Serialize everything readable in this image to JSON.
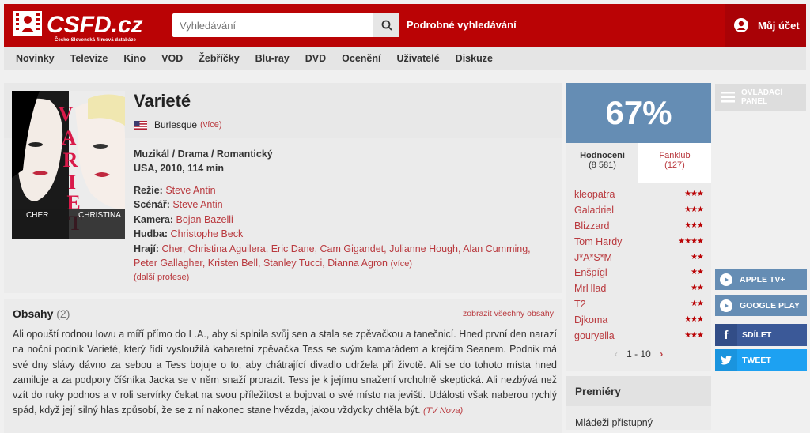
{
  "header": {
    "logo_text": "CSFD.cz",
    "logo_subtitle": "Česko-Slovenská filmová databáze",
    "search_placeholder": "Vyhledávání",
    "advanced_search": "Podrobné vyhledávání",
    "account": "Můj účet"
  },
  "nav": [
    "Novinky",
    "Televize",
    "Kino",
    "VOD",
    "Žebříčky",
    "Blu-ray",
    "DVD",
    "Ocenění",
    "Uživatelé",
    "Diskuze"
  ],
  "film": {
    "title": "Varieté",
    "original_title": "Burlesque",
    "more": "(více)",
    "genre": "Muzikál / Drama / Romantický",
    "origin": "USA, 2010, 114 min",
    "director_label": "Režie:",
    "director": "Steve Antin",
    "writer_label": "Scénář:",
    "writer": "Steve Antin",
    "camera_label": "Kamera:",
    "camera": "Bojan Bazelli",
    "music_label": "Hudba:",
    "music": "Christophe Beck",
    "cast_label": "Hrají:",
    "cast": "Cher, Christina Aguilera, Eric Dane, Cam Gigandet, Julianne Hough, Alan Cumming, Peter Gallagher, Kristen Bell, Stanley Tucci, Dianna Agron",
    "cast_more": "(více)",
    "other_professions": "(další profese)",
    "poster": {
      "title_letters": "VARIETÉ",
      "left_name": "CHER",
      "right_name": "CHRISTINA"
    }
  },
  "plots": {
    "title": "Obsahy",
    "count": "(2)",
    "show_all": "zobrazit všechny obsahy",
    "text": "Ali opouští rodnou Iowu a míří přímo do L.A., aby si splnila svůj sen a stala se zpěvačkou a tanečnicí. Hned první den narazí na noční podnik Varieté, který řídí vysloužilá kabaretní zpěvačka Tess se svým kamarádem a krejčím Seanem. Podnik má své dny slávy dávno za sebou a Tess bojuje o to, aby chátrající divadlo udržela při životě. Ali se do tohoto místa hned zamiluje a za podpory číšníka Jacka se v něm snaží prorazit. Tess je k jejímu snažení vrcholně skeptická. Ali nezbývá než vzít do ruky podnos a v roli servírky čekat na svou příležitost a bojovat o své místo na jevišti. Události však naberou rychlý spád, když její silný hlas způsobí, že se z ní nakonec stane hvězda, jakou vždycky chtěla být.",
    "source": "(TV Nova)"
  },
  "rating": {
    "percent": "67%",
    "tab_ratings": "Hodnocení",
    "tab_ratings_count": "(8 581)",
    "tab_fanclub": "Fanklub",
    "tab_fanclub_count": "(127)",
    "users": [
      {
        "name": "kleopatra",
        "stars": "★★★"
      },
      {
        "name": "Galadriel",
        "stars": "★★★"
      },
      {
        "name": "Blizzard",
        "stars": "★★★"
      },
      {
        "name": "Tom Hardy",
        "stars": "★★★★"
      },
      {
        "name": "J*A*S*M",
        "stars": "★★"
      },
      {
        "name": "Enšpígl",
        "stars": "★★"
      },
      {
        "name": "MrHlad",
        "stars": "★★"
      },
      {
        "name": "T2",
        "stars": "★★"
      },
      {
        "name": "Djkoma",
        "stars": "★★★"
      },
      {
        "name": "gouryella",
        "stars": "★★★"
      }
    ],
    "pager": "1 - 10",
    "pager_prev": "‹",
    "pager_next": "›"
  },
  "premieres": {
    "title": "Premiéry",
    "item": "Mládeži přístupný"
  },
  "sidebar": {
    "control_panel_line1": "OVLÁDACÍ",
    "control_panel_line2": "PANEL",
    "apple_tv": "APPLE TV+",
    "google_play": "GOOGLE PLAY",
    "share": "SDÍLET",
    "tweet": "TWEET"
  },
  "colors": {
    "brand_red": "#ba0305",
    "link_red": "#b9393e",
    "rating_blue": "#658db4",
    "facebook": "#3b5998",
    "twitter": "#1da1f2"
  }
}
